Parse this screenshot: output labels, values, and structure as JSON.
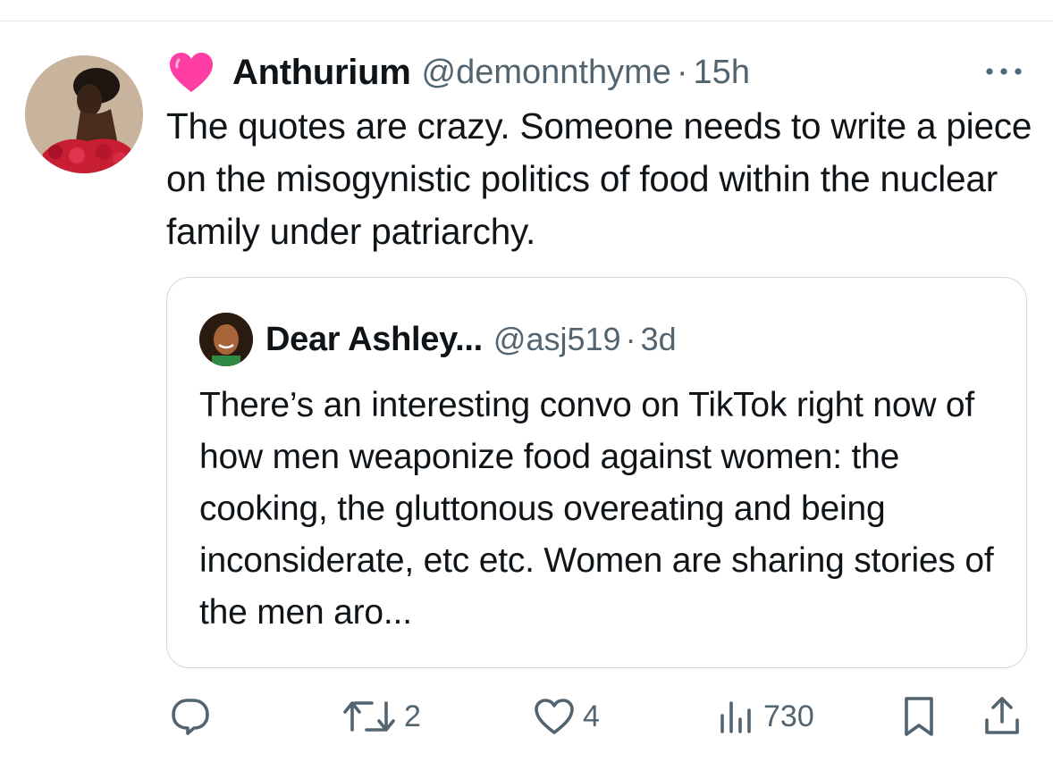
{
  "tweet": {
    "display_name": "Anthurium",
    "handle": "@demonnthyme",
    "separator": "·",
    "time": "15h",
    "text": "The quotes are crazy. Someone needs to write a piece on the misogynistic politics of food within the nuclear family under patriarchy.",
    "name_emoji": "pink-heart-icon"
  },
  "quote": {
    "display_name": "Dear Ashley...",
    "handle": "@asj519",
    "separator": "·",
    "time": "3d",
    "text": "There’s an interesting convo on TikTok right now of how men weaponize food against women: the cooking, the gluttonous overeating and being inconsiderate, etc etc. Women are sharing stories of the men aro..."
  },
  "actions": {
    "reply_count": "",
    "retweet_count": "2",
    "like_count": "4",
    "views_count": "730"
  },
  "colors": {
    "text_primary": "#0f1419",
    "text_secondary": "#536471",
    "border": "#cfd9de",
    "heart": "#ff3ea5"
  },
  "icons": [
    "more-icon",
    "reply-icon",
    "retweet-icon",
    "like-icon",
    "views-icon",
    "bookmark-icon",
    "share-icon"
  ]
}
